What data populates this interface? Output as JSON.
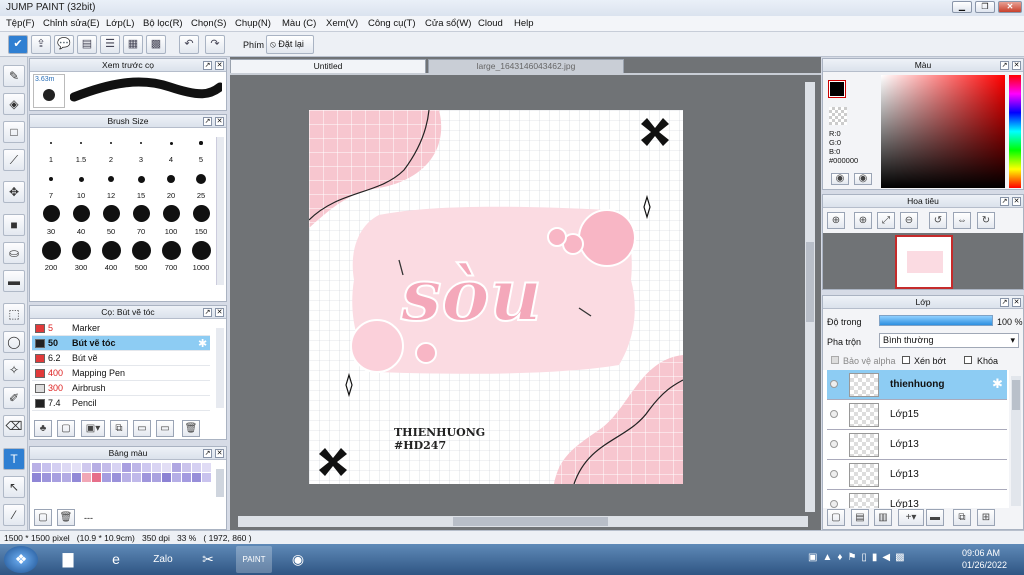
{
  "window": {
    "title": "JUMP PAINT (32bit)"
  },
  "menu": [
    "Tệp(F)",
    "Chỉnh sửa(E)",
    "Lớp(L)",
    "Bộ lọc(R)",
    "Chọn(S)",
    "Chụp(N)",
    "Màu (C)",
    "Xem(V)",
    "Công cụ(T)",
    "Cửa sổ(W)",
    "Cloud",
    "Help"
  ],
  "toolbar": {
    "shortcut_label": "Phím",
    "reset_label": "Đặt lại"
  },
  "brush_preview": {
    "title": "Xem trước cọ",
    "size": "3.63m"
  },
  "brush_size": {
    "title": "Brush Size",
    "sizes": [
      "1",
      "1.5",
      "2",
      "3",
      "4",
      "5",
      "7",
      "10",
      "12",
      "15",
      "20",
      "25",
      "30",
      "40",
      "50",
      "70",
      "100",
      "150",
      "200",
      "300",
      "400",
      "500",
      "700",
      "1000"
    ]
  },
  "brush_list": {
    "title": "Cọ: Bút vẽ tóc",
    "items": [
      {
        "size": "5",
        "name": "Marker",
        "color": "#e23a3a"
      },
      {
        "size": "50",
        "name": "Bút vẽ tóc",
        "color": "#222222"
      },
      {
        "size": "6.2",
        "name": "Bút vẽ",
        "color": "#e23a3a"
      },
      {
        "size": "400",
        "name": "Mapping Pen",
        "color": "#e23a3a"
      },
      {
        "size": "300",
        "name": "Airbrush",
        "color": "#dddddd"
      },
      {
        "size": "7.4",
        "name": "Pencil",
        "color": "#222222"
      }
    ]
  },
  "palette": {
    "title": "Bảng màu",
    "footer": "---"
  },
  "tabs": [
    {
      "label": "Untitled"
    },
    {
      "label": "large_1643146043462.jpg"
    }
  ],
  "artwork": {
    "main_text": "sòu",
    "credit1": "THIENHUONG",
    "credit2": "#HD247"
  },
  "color_panel": {
    "title": "Màu",
    "r": "R:0",
    "g": "G:0",
    "b": "B:0",
    "hex": "#000000"
  },
  "navigator": {
    "title": "Hoa tiêu"
  },
  "layers": {
    "title": "Lớp",
    "opacity_label": "Độ trong",
    "opacity_value": "100 %",
    "blend_label": "Pha trộn",
    "blend_value": "Bình thường",
    "protect_alpha": "Bảo vệ alpha",
    "clip": "Xén bớt",
    "lock": "Khóa",
    "items": [
      {
        "name": "thienhuong"
      },
      {
        "name": "Lớp15"
      },
      {
        "name": "Lớp13"
      },
      {
        "name": "Lớp13"
      },
      {
        "name": "Lớp13"
      }
    ]
  },
  "status": {
    "text": "1500 * 1500 pixel   (10.9 * 10.9cm)   350 dpi   33 %   ( 1972, 860 )"
  },
  "taskbar": {
    "time": "09:06 AM",
    "date": "01/26/2022"
  }
}
